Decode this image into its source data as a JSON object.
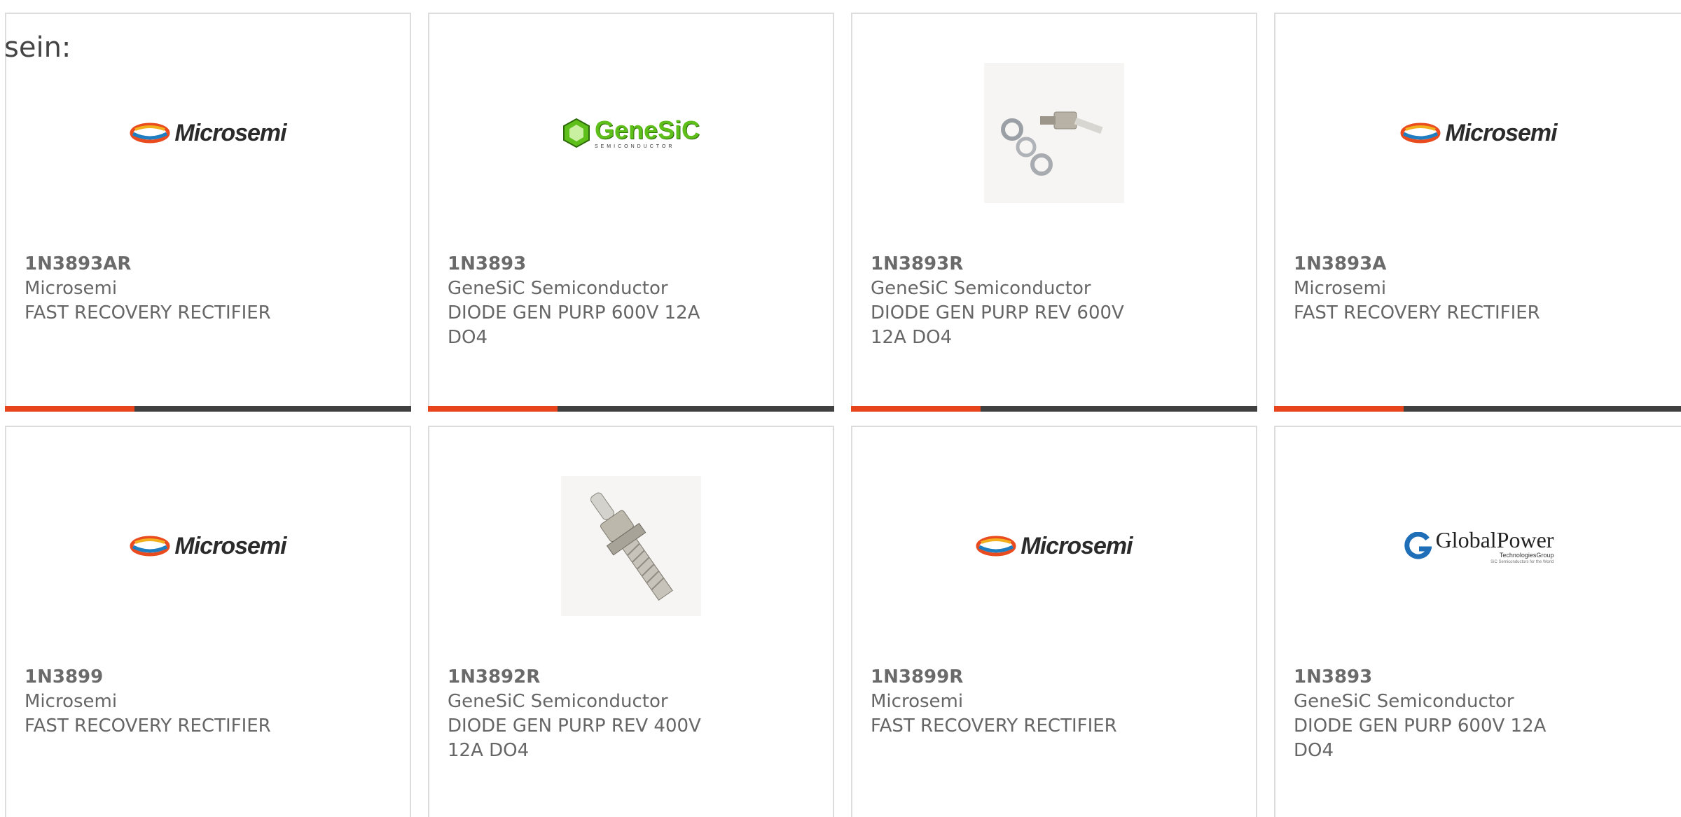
{
  "intro_text": "sein:",
  "brand_colors": {
    "accent": "#e8441c",
    "bar_dark": "#404040",
    "text": "#666666"
  },
  "logos": {
    "microsemi": "Microsemi",
    "genesic_main": "GeneSiC",
    "genesic_sub": "SEMICONDUCTOR",
    "global_main": "GlobalPower",
    "global_sub": "TechnologiesGroup",
    "global_tiny": "SiC Semiconductors for the World"
  },
  "products": [
    {
      "part": "1N3893AR",
      "maker": "Microsemi",
      "desc": "FAST RECOVERY RECTIFIER",
      "image": "microsemi-logo",
      "show_bar": true
    },
    {
      "part": "1N3893",
      "maker": "GeneSiC Semiconductor",
      "desc": "DIODE GEN PURP 600V 12A DO4",
      "image": "genesic-logo",
      "show_bar": true
    },
    {
      "part": "1N3893R",
      "maker": "GeneSiC Semiconductor",
      "desc": "DIODE GEN PURP REV 600V 12A DO4",
      "image": "stud-diode-with-washers-photo",
      "show_bar": true
    },
    {
      "part": "1N3893A",
      "maker": "Microsemi",
      "desc": "FAST RECOVERY RECTIFIER",
      "image": "microsemi-logo",
      "show_bar": true
    },
    {
      "part": "1N3899",
      "maker": "Microsemi",
      "desc": "FAST RECOVERY RECTIFIER",
      "image": "microsemi-logo",
      "show_bar": false
    },
    {
      "part": "1N3892R",
      "maker": "GeneSiC Semiconductor",
      "desc": "DIODE GEN PURP REV 400V 12A DO4",
      "image": "stud-diode-photo",
      "show_bar": false
    },
    {
      "part": "1N3899R",
      "maker": "Microsemi",
      "desc": "FAST RECOVERY RECTIFIER",
      "image": "microsemi-logo",
      "show_bar": false
    },
    {
      "part": "1N3893",
      "maker": "GeneSiC Semiconductor",
      "desc": "DIODE GEN PURP 600V 12A DO4",
      "image": "globalpower-logo",
      "show_bar": false
    }
  ]
}
